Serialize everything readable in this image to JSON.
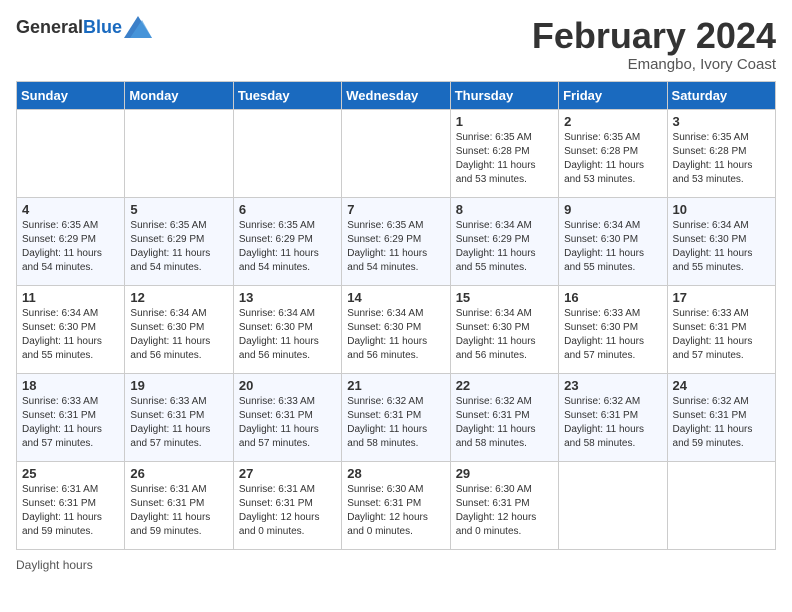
{
  "header": {
    "logo_general": "General",
    "logo_blue": "Blue",
    "month_title": "February 2024",
    "subtitle": "Emangbo, Ivory Coast"
  },
  "days_of_week": [
    "Sunday",
    "Monday",
    "Tuesday",
    "Wednesday",
    "Thursday",
    "Friday",
    "Saturday"
  ],
  "footer": {
    "daylight_hours": "Daylight hours"
  },
  "weeks": [
    {
      "cells": [
        {
          "day": "",
          "info": ""
        },
        {
          "day": "",
          "info": ""
        },
        {
          "day": "",
          "info": ""
        },
        {
          "day": "",
          "info": ""
        },
        {
          "day": "1",
          "info": "Sunrise: 6:35 AM\nSunset: 6:28 PM\nDaylight: 11 hours and 53 minutes."
        },
        {
          "day": "2",
          "info": "Sunrise: 6:35 AM\nSunset: 6:28 PM\nDaylight: 11 hours and 53 minutes."
        },
        {
          "day": "3",
          "info": "Sunrise: 6:35 AM\nSunset: 6:28 PM\nDaylight: 11 hours and 53 minutes."
        }
      ]
    },
    {
      "cells": [
        {
          "day": "4",
          "info": "Sunrise: 6:35 AM\nSunset: 6:29 PM\nDaylight: 11 hours and 54 minutes."
        },
        {
          "day": "5",
          "info": "Sunrise: 6:35 AM\nSunset: 6:29 PM\nDaylight: 11 hours and 54 minutes."
        },
        {
          "day": "6",
          "info": "Sunrise: 6:35 AM\nSunset: 6:29 PM\nDaylight: 11 hours and 54 minutes."
        },
        {
          "day": "7",
          "info": "Sunrise: 6:35 AM\nSunset: 6:29 PM\nDaylight: 11 hours and 54 minutes."
        },
        {
          "day": "8",
          "info": "Sunrise: 6:34 AM\nSunset: 6:29 PM\nDaylight: 11 hours and 55 minutes."
        },
        {
          "day": "9",
          "info": "Sunrise: 6:34 AM\nSunset: 6:30 PM\nDaylight: 11 hours and 55 minutes."
        },
        {
          "day": "10",
          "info": "Sunrise: 6:34 AM\nSunset: 6:30 PM\nDaylight: 11 hours and 55 minutes."
        }
      ]
    },
    {
      "cells": [
        {
          "day": "11",
          "info": "Sunrise: 6:34 AM\nSunset: 6:30 PM\nDaylight: 11 hours and 55 minutes."
        },
        {
          "day": "12",
          "info": "Sunrise: 6:34 AM\nSunset: 6:30 PM\nDaylight: 11 hours and 56 minutes."
        },
        {
          "day": "13",
          "info": "Sunrise: 6:34 AM\nSunset: 6:30 PM\nDaylight: 11 hours and 56 minutes."
        },
        {
          "day": "14",
          "info": "Sunrise: 6:34 AM\nSunset: 6:30 PM\nDaylight: 11 hours and 56 minutes."
        },
        {
          "day": "15",
          "info": "Sunrise: 6:34 AM\nSunset: 6:30 PM\nDaylight: 11 hours and 56 minutes."
        },
        {
          "day": "16",
          "info": "Sunrise: 6:33 AM\nSunset: 6:30 PM\nDaylight: 11 hours and 57 minutes."
        },
        {
          "day": "17",
          "info": "Sunrise: 6:33 AM\nSunset: 6:31 PM\nDaylight: 11 hours and 57 minutes."
        }
      ]
    },
    {
      "cells": [
        {
          "day": "18",
          "info": "Sunrise: 6:33 AM\nSunset: 6:31 PM\nDaylight: 11 hours and 57 minutes."
        },
        {
          "day": "19",
          "info": "Sunrise: 6:33 AM\nSunset: 6:31 PM\nDaylight: 11 hours and 57 minutes."
        },
        {
          "day": "20",
          "info": "Sunrise: 6:33 AM\nSunset: 6:31 PM\nDaylight: 11 hours and 57 minutes."
        },
        {
          "day": "21",
          "info": "Sunrise: 6:32 AM\nSunset: 6:31 PM\nDaylight: 11 hours and 58 minutes."
        },
        {
          "day": "22",
          "info": "Sunrise: 6:32 AM\nSunset: 6:31 PM\nDaylight: 11 hours and 58 minutes."
        },
        {
          "day": "23",
          "info": "Sunrise: 6:32 AM\nSunset: 6:31 PM\nDaylight: 11 hours and 58 minutes."
        },
        {
          "day": "24",
          "info": "Sunrise: 6:32 AM\nSunset: 6:31 PM\nDaylight: 11 hours and 59 minutes."
        }
      ]
    },
    {
      "cells": [
        {
          "day": "25",
          "info": "Sunrise: 6:31 AM\nSunset: 6:31 PM\nDaylight: 11 hours and 59 minutes."
        },
        {
          "day": "26",
          "info": "Sunrise: 6:31 AM\nSunset: 6:31 PM\nDaylight: 11 hours and 59 minutes."
        },
        {
          "day": "27",
          "info": "Sunrise: 6:31 AM\nSunset: 6:31 PM\nDaylight: 12 hours and 0 minutes."
        },
        {
          "day": "28",
          "info": "Sunrise: 6:30 AM\nSunset: 6:31 PM\nDaylight: 12 hours and 0 minutes."
        },
        {
          "day": "29",
          "info": "Sunrise: 6:30 AM\nSunset: 6:31 PM\nDaylight: 12 hours and 0 minutes."
        },
        {
          "day": "",
          "info": ""
        },
        {
          "day": "",
          "info": ""
        }
      ]
    }
  ]
}
